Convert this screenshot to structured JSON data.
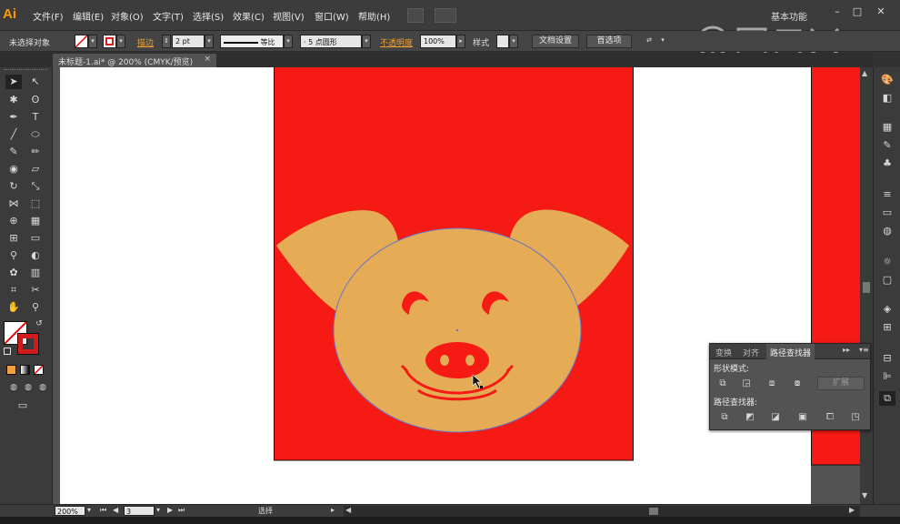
{
  "app": {
    "logo": "Ai"
  },
  "menu": [
    "文件(F)",
    "编辑(E)",
    "对象(O)",
    "文字(T)",
    "选择(S)",
    "效果(C)",
    "视图(V)",
    "窗口(W)",
    "帮助(H)"
  ],
  "workspace": "基本功能",
  "window_controls": [
    "–",
    "□",
    "✕"
  ],
  "control_bar": {
    "selection_label": "未选择对象",
    "stroke_label": "描边",
    "stroke_weight": "2 pt",
    "stroke_profile": "等比",
    "brush": "5 点圆形",
    "opacity_label": "不透明度",
    "opacity": "100%",
    "style_label": "样式",
    "doc_setup": "文档设置",
    "preferences": "首选项"
  },
  "document_tab": {
    "title": "未标题-1.ai* @ 200% (CMYK/预览)",
    "close": "×"
  },
  "status_bar": {
    "zoom": "200%",
    "artboard": "3",
    "tool": "选择"
  },
  "panel": {
    "tabs": [
      "变换",
      "对齐",
      "路径查找器"
    ],
    "active_tab": "路径查找器",
    "shape_modes_label": "形状模式:",
    "expand_button": "扩展",
    "pathfinders_label": "路径查找器:"
  },
  "colors": {
    "artboard_red": "#f51a14",
    "pig_face": "#e5ac55",
    "selection_outline": "#6a74c9",
    "accent_orange": "#ff9a00"
  },
  "watermark": "虎课网"
}
